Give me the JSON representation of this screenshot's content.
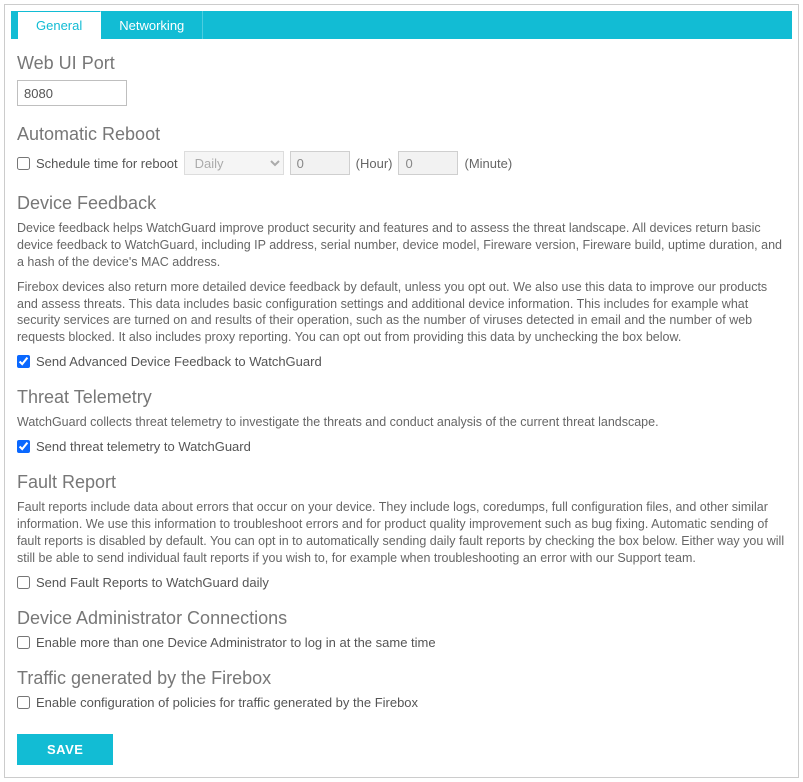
{
  "tabs": {
    "general": "General",
    "networking": "Networking"
  },
  "webui": {
    "heading": "Web UI Port",
    "port_value": "8080"
  },
  "reboot": {
    "heading": "Automatic Reboot",
    "schedule_label": "Schedule time for reboot",
    "freq_value": "Daily",
    "hour_value": "0",
    "hour_unit": "(Hour)",
    "minute_value": "0",
    "minute_unit": "(Minute)"
  },
  "feedback": {
    "heading": "Device Feedback",
    "p1": "Device feedback helps WatchGuard improve product security and features and to assess the threat landscape. All devices return basic device feedback to WatchGuard, including IP address, serial number, device model, Fireware version, Fireware build, uptime duration, and a hash of the device's MAC address.",
    "p2": "Firebox devices also return more detailed device feedback by default, unless you opt out. We also use this data to improve our products and assess threats. This data includes basic configuration settings and additional device information. This includes for example what security services are turned on and results of their operation, such as the number of viruses detected in email and the number of web requests blocked. It also includes proxy reporting. You can opt out from providing this data by unchecking the box below.",
    "checkbox_label": "Send Advanced Device Feedback to WatchGuard"
  },
  "telemetry": {
    "heading": "Threat Telemetry",
    "p1": "WatchGuard collects threat telemetry to investigate the threats and conduct analysis of the current threat landscape.",
    "checkbox_label": "Send threat telemetry to WatchGuard"
  },
  "fault": {
    "heading": "Fault Report",
    "p1": "Fault reports include data about errors that occur on your device. They include logs, coredumps, full configuration files, and other similar information. We use this information to troubleshoot errors and for product quality improvement such as bug fixing. Automatic sending of fault reports is disabled by default. You can opt in to automatically sending daily fault reports by checking the box below. Either way you will still be able to send individual fault reports if you wish to, for example when troubleshooting an error with our Support team.",
    "checkbox_label": "Send Fault Reports to WatchGuard daily"
  },
  "admin": {
    "heading": "Device Administrator Connections",
    "checkbox_label": "Enable more than one Device Administrator to log in at the same time"
  },
  "traffic": {
    "heading": "Traffic generated by the Firebox",
    "checkbox_label": "Enable configuration of policies for traffic generated by the Firebox"
  },
  "save_label": "SAVE"
}
